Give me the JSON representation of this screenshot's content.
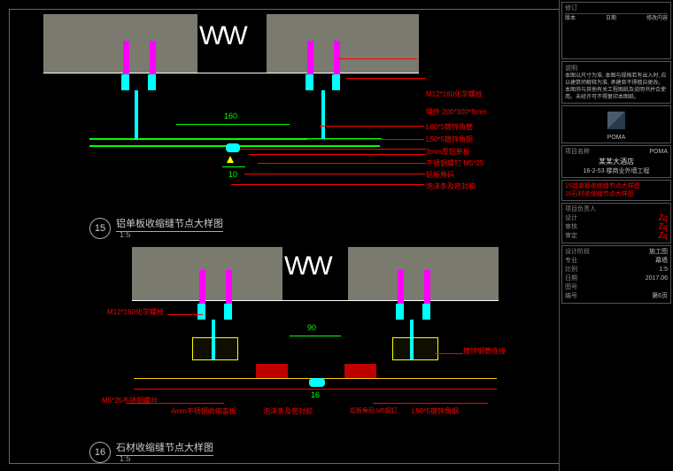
{
  "drawing15": {
    "number": "15",
    "title": "铝单板收缩缝节点大样图",
    "scale": "1:5",
    "dim_h": "160",
    "dim_gap": "10",
    "labels": [
      "M12*160化学螺栓",
      "埋件 200*300*8mm",
      "L60*5镀锌角管",
      "L50*5镀锌角钢",
      "3mm厚铝单板",
      "不锈钢螺钉 M5*25",
      "铝板角码",
      "泡沫条及密封胶"
    ]
  },
  "drawing16": {
    "number": "16",
    "title": "石材收缩缝节点大样图",
    "scale": "1:5",
    "dim_gap": "90",
    "dim_small": "16",
    "labels_left": [
      "M12*160化学螺栓",
      "M5*25不锈钢螺丝",
      "4mm不锈钢收缩盖板",
      "泡沫条及密封胶"
    ],
    "labels_right": [
      "镀锌钢管连接",
      "L50*5镀锌角钢",
      "铝板角码 M5钢钉"
    ]
  },
  "sidebar": {
    "rev_header": "修订",
    "rev_cols": [
      "版本",
      "日期",
      "修改内容"
    ],
    "notes_title": "说明",
    "notes_body": "本图以尺寸为准, 本图与规格若有出入时, 应以建筑师解释为准, 承建商不得擅自更改。本图须与其他有关工程图纸及说明书并合使用。未经许可不得复印本图纸。",
    "company": "POMA",
    "project_label": "项目名称",
    "project_name": "POMA",
    "subproject": "某某大酒店",
    "sheet_code": "16-2-53 楼商业外墙工程",
    "sheet_titles": [
      "15铝单板收缩缝节点大样图",
      "16石材收缩缝节点大样图"
    ],
    "roles": [
      {
        "k": "项目负责人",
        "v": ""
      },
      {
        "k": "设计",
        "v": "签名"
      },
      {
        "k": "审核",
        "v": "签名"
      },
      {
        "k": "审定",
        "v": "签名"
      }
    ],
    "stage_k": "设计阶段",
    "stage_v": "施工图",
    "major_k": "专业",
    "major_v": "幕墙",
    "scale_k": "比例",
    "scale_v": "1:5",
    "date_k": "日期",
    "date_v": "2017.06",
    "dwgno_k": "图号",
    "dwgno_v": "",
    "serial_k": "编号",
    "serial_v": "第6页"
  }
}
